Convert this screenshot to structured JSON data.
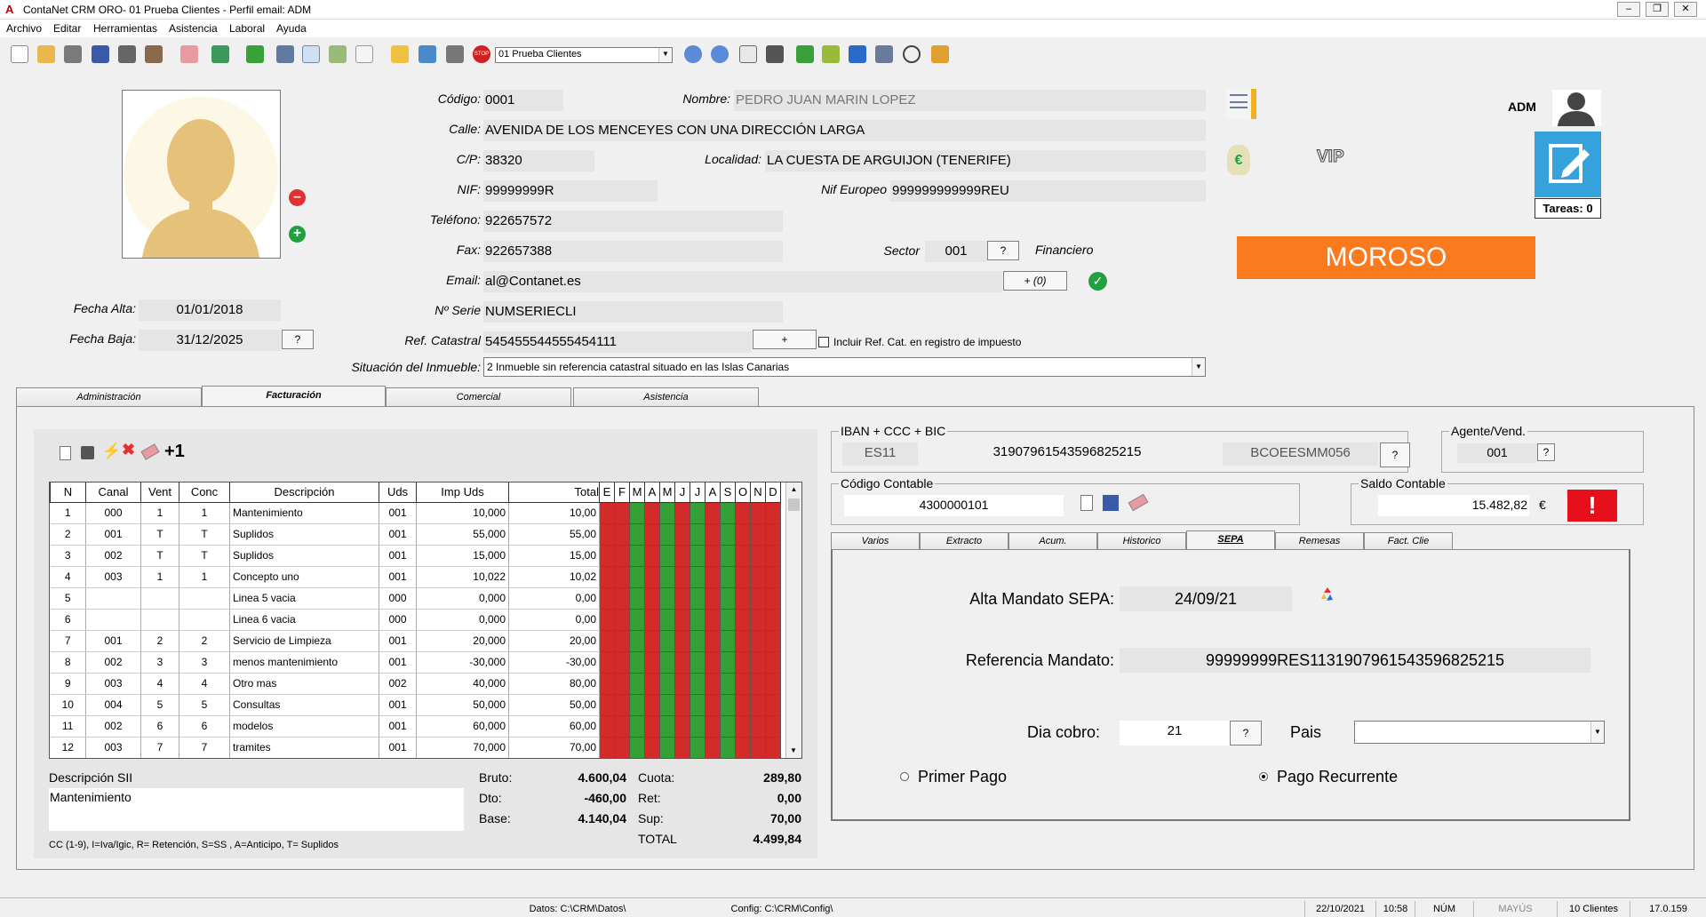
{
  "window": {
    "title": "ContaNet CRM ORO- 01 Prueba Clientes - Perfil email: ADM"
  },
  "menu": [
    "Archivo",
    "Editar",
    "Herramientas",
    "Asistencia",
    "Laboral",
    "Ayuda"
  ],
  "toolbar": {
    "company": "01 Prueba Clientes"
  },
  "client": {
    "codigo_label": "Código:",
    "codigo": "0001",
    "nombre_label": "Nombre:",
    "nombre": "PEDRO JUAN MARIN LOPEZ",
    "calle_label": "Calle:",
    "calle": "AVENIDA DE LOS MENCEYES CON UNA DIRECCIÓN LARGA",
    "cp_label": "C/P:",
    "cp": "38320",
    "localidad_label": "Localidad:",
    "localidad": "LA CUESTA DE ARGUIJON (TENERIFE)",
    "nif_label": "NIF:",
    "nif": "99999999R",
    "nif_eu_label": "Nif Europeo",
    "nif_eu": "999999999999REU",
    "telefono_label": "Teléfono:",
    "telefono": "922657572",
    "fax_label": "Fax:",
    "fax": "922657388",
    "sector_label": "Sector",
    "sector": "001",
    "sector_name": "Financiero",
    "email_label": "Email:",
    "email": "al@Contanet.es",
    "email_btn": "+ (0)",
    "serie_label": "Nº Serie",
    "serie": "NUMSERIECLI",
    "catastral_label": "Ref. Catastral",
    "catastral": "545455544555454111",
    "catastral_btn": "+",
    "incluir_label": "Incluir Ref. Cat. en registro de impuesto",
    "situacion_label": "Situación del Inmueble:",
    "situacion": "2 Inmueble sin referencia catastral situado en las Islas Canarias",
    "fecha_alta_label": "Fecha Alta:",
    "fecha_alta": "01/01/2018",
    "fecha_baja_label": "Fecha Baja:",
    "fecha_baja": "31/12/2025",
    "q": "?"
  },
  "side": {
    "user": "ADM",
    "vip": "VIP",
    "tareas": "Tareas: 0",
    "moroso": "MOROSO"
  },
  "tabs": [
    "Administración",
    "Facturación",
    "Comercial",
    "Asistencia"
  ],
  "invoice": {
    "plus1": "+1",
    "headers": [
      "N",
      "Canal",
      "Vent",
      "Conc",
      "Descripción",
      "Uds",
      "Imp Uds",
      "Total",
      "E",
      "F",
      "M",
      "A",
      "M",
      "J",
      "J",
      "A",
      "S",
      "O",
      "N",
      "D"
    ],
    "rows": [
      [
        "1",
        "000",
        "1",
        "1",
        "Mantenimiento",
        "001",
        "10,000",
        "10,00"
      ],
      [
        "2",
        "001",
        "T",
        "T",
        "Suplidos",
        "001",
        "55,000",
        "55,00"
      ],
      [
        "3",
        "002",
        "T",
        "T",
        "Suplidos",
        "001",
        "15,000",
        "15,00"
      ],
      [
        "4",
        "003",
        "1",
        "1",
        "Concepto uno",
        "001",
        "10,022",
        "10,02"
      ],
      [
        "5",
        "",
        "",
        "",
        "Linea 5 vacia",
        "000",
        "0,000",
        "0,00"
      ],
      [
        "6",
        "",
        "",
        "",
        "Linea 6 vacia",
        "000",
        "0,000",
        "0,00"
      ],
      [
        "7",
        "001",
        "2",
        "2",
        "Servicio de Limpieza",
        "001",
        "20,000",
        "20,00"
      ],
      [
        "8",
        "002",
        "3",
        "3",
        "menos mantenimiento",
        "001",
        "-30,000",
        "-30,00"
      ],
      [
        "9",
        "003",
        "4",
        "4",
        "Otro mas",
        "002",
        "40,000",
        "80,00"
      ],
      [
        "10",
        "004",
        "5",
        "5",
        "Consultas",
        "001",
        "50,000",
        "50,00"
      ],
      [
        "11",
        "002",
        "6",
        "6",
        "modelos",
        "001",
        "60,000",
        "60,00"
      ],
      [
        "12",
        "003",
        "7",
        "7",
        "tramites",
        "001",
        "70,000",
        "70,00"
      ]
    ],
    "month_colors": [
      "red",
      "red",
      "green",
      "red",
      "green",
      "red",
      "green",
      "red",
      "green",
      "red",
      "red",
      "red"
    ],
    "sii_label": "Descripción SII",
    "sii": "Mantenimiento",
    "legend": "CC (1-9), I=Iva/Igic, R= Retención, S=SS , A=Anticipo, T= Suplidos",
    "bruto_label": "Bruto:",
    "bruto": "4.600,04",
    "dto_label": "Dto:",
    "dto": "-460,00",
    "base_label": "Base:",
    "base": "4.140,04",
    "cuota_label": "Cuota:",
    "cuota": "289,80",
    "ret_label": "Ret:",
    "ret": "0,00",
    "sup_label": "Sup:",
    "sup": "70,00",
    "total_label": "TOTAL",
    "total": "4.499,84"
  },
  "bank": {
    "title": "IBAN + CCC + BIC",
    "iban": "ES11",
    "ccc": "31907961543596825215",
    "bic": "BCOEESMM056"
  },
  "agente": {
    "title": "Agente/Vend.",
    "value": "001"
  },
  "contable": {
    "title": "Código Contable",
    "value": "4300000101"
  },
  "saldo": {
    "title": "Saldo Contable",
    "value": "15.482,82",
    "currency": "€"
  },
  "subtabs": [
    "Varios",
    "Extracto",
    "Acum.",
    "Historico",
    "SEPA",
    "Remesas",
    "Fact. Clie"
  ],
  "sepa": {
    "alta_label": "Alta Mandato SEPA:",
    "alta": "24/09/21",
    "ref_label": "Referencia Mandato:",
    "ref": "99999999RES1131907961543596825215",
    "dia_label": "Dia cobro:",
    "dia": "21",
    "pais_label": "Pais",
    "pais": "",
    "primer": "Primer Pago",
    "recurrente": "Pago Recurrente"
  },
  "statusbar": {
    "datos": "Datos: C:\\CRM\\Datos\\",
    "config": "Config: C:\\CRM\\Config\\",
    "date": "22/10/2021",
    "time": "10:58",
    "num": "NÚM",
    "mayus": "MAYÚS",
    "clientes": "10 Clientes",
    "version": "17.0.159"
  }
}
